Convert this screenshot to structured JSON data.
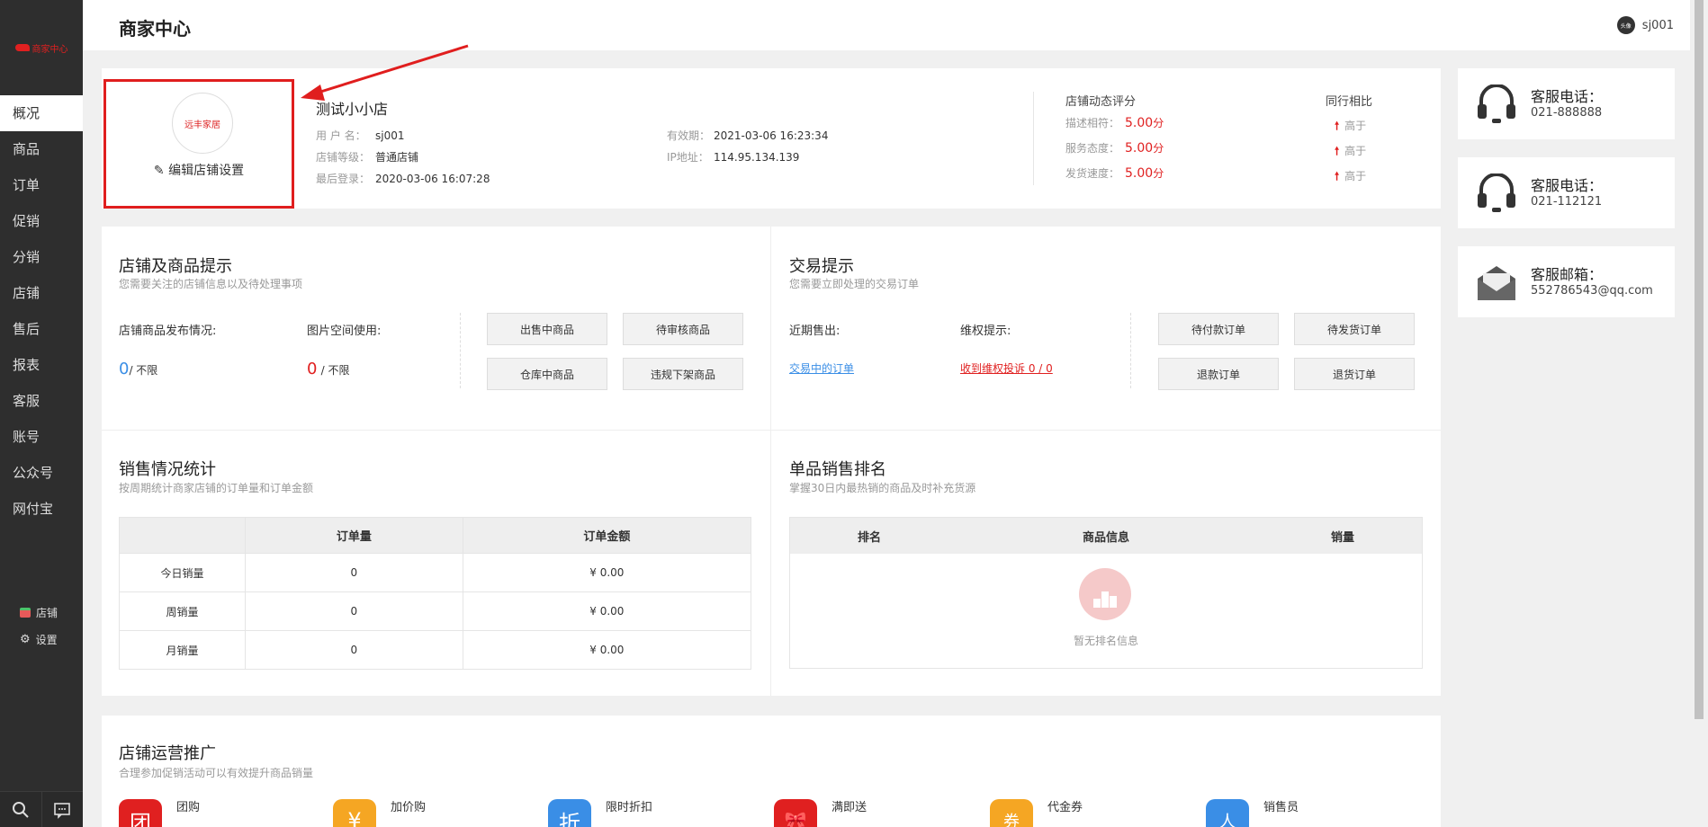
{
  "app": {
    "title": "商家中心",
    "logo_text": "商家中心",
    "user": "sj001",
    "avatar_text": "头像"
  },
  "sidebar": {
    "items": [
      {
        "label": "概况"
      },
      {
        "label": "商品"
      },
      {
        "label": "订单"
      },
      {
        "label": "促销"
      },
      {
        "label": "分销"
      },
      {
        "label": "店铺"
      },
      {
        "label": "售后"
      },
      {
        "label": "报表"
      },
      {
        "label": "客服"
      },
      {
        "label": "账号"
      },
      {
        "label": "公众号"
      },
      {
        "label": "网付宝"
      }
    ],
    "shop_link": "店铺",
    "settings_link": "设置"
  },
  "shop": {
    "logo_text": "远丰家居",
    "edit_label": "编辑店铺设置",
    "name": "测试小小店",
    "username_key": "用 户 名：",
    "username": "sj001",
    "level_key": "店铺等级：",
    "level": "普通店铺",
    "last_login_key": "最后登录：",
    "last_login": "2020-03-06 16:07:28",
    "valid_key": "有效期：",
    "valid": "2021-03-06 16:23:34",
    "ip_key": "IP地址：",
    "ip": "114.95.134.139"
  },
  "ratings": {
    "title": "店铺动态评分",
    "compare_title": "同行相比",
    "rows": [
      {
        "label": "描述相符：",
        "value": "5.00",
        "unit": "分",
        "compare": "高于"
      },
      {
        "label": "服务态度：",
        "value": "5.00",
        "unit": "分",
        "compare": "高于"
      },
      {
        "label": "发货速度：",
        "value": "5.00",
        "unit": "分",
        "compare": "高于"
      }
    ]
  },
  "contacts": [
    {
      "title": "客服电话：",
      "value": "021-888888",
      "icon": "headset-icon"
    },
    {
      "title": "客服电话：",
      "value": "021-112121",
      "icon": "headset-icon"
    },
    {
      "title": "客服邮箱：",
      "value": "552786543@qq.com",
      "icon": "mail-icon"
    }
  ],
  "store_tips": {
    "title": "店铺及商品提示",
    "subtitle": "您需要关注的店铺信息以及待处理事项",
    "publish_label": "店铺商品发布情况:",
    "publish_count": "0",
    "publish_limit": "/ 不限",
    "space_label": "图片空间使用:",
    "space_count": "0",
    "space_limit": "/ 不限",
    "buttons": [
      "出售中商品",
      "待审核商品",
      "仓库中商品",
      "违规下架商品"
    ]
  },
  "trade_tips": {
    "title": "交易提示",
    "subtitle": "您需要立即处理的交易订单",
    "recent_label": "近期售出:",
    "rights_label": "维权提示:",
    "recent_link": "交易中的订单",
    "rights_link": "收到维权投诉 0 / 0",
    "buttons": [
      "待付款订单",
      "待发货订单",
      "退款订单",
      "退货订单"
    ]
  },
  "sales": {
    "title": "销售情况统计",
    "subtitle": "按周期统计商家店铺的订单量和订单金额",
    "headers": [
      "",
      "订单量",
      "订单金额"
    ],
    "rows": [
      [
        "今日销量",
        "0",
        "¥ 0.00"
      ],
      [
        "周销量",
        "0",
        "¥ 0.00"
      ],
      [
        "月销量",
        "0",
        "¥ 0.00"
      ]
    ]
  },
  "ranking": {
    "title": "单品销售排名",
    "subtitle": "掌握30日内最热销的商品及时补充货源",
    "headers": [
      "排名",
      "商品信息",
      "销量"
    ],
    "empty_text": "暂无排名信息"
  },
  "promotion": {
    "title": "店铺运营推广",
    "subtitle": "合理参加促销活动可以有效提升商品销量",
    "items": [
      {
        "label": "团购",
        "glyph": "团",
        "color": "#e02020"
      },
      {
        "label": "加价购",
        "glyph": "¥",
        "color": "#f5a623"
      },
      {
        "label": "限时折扣",
        "glyph": "折",
        "color": "#3a8ee6"
      },
      {
        "label": "满即送",
        "glyph": "🎀",
        "color": "#e02020"
      },
      {
        "label": "代金券",
        "glyph": "券",
        "color": "#f5a623"
      },
      {
        "label": "销售员",
        "glyph": "人",
        "color": "#3a8ee6"
      }
    ]
  }
}
